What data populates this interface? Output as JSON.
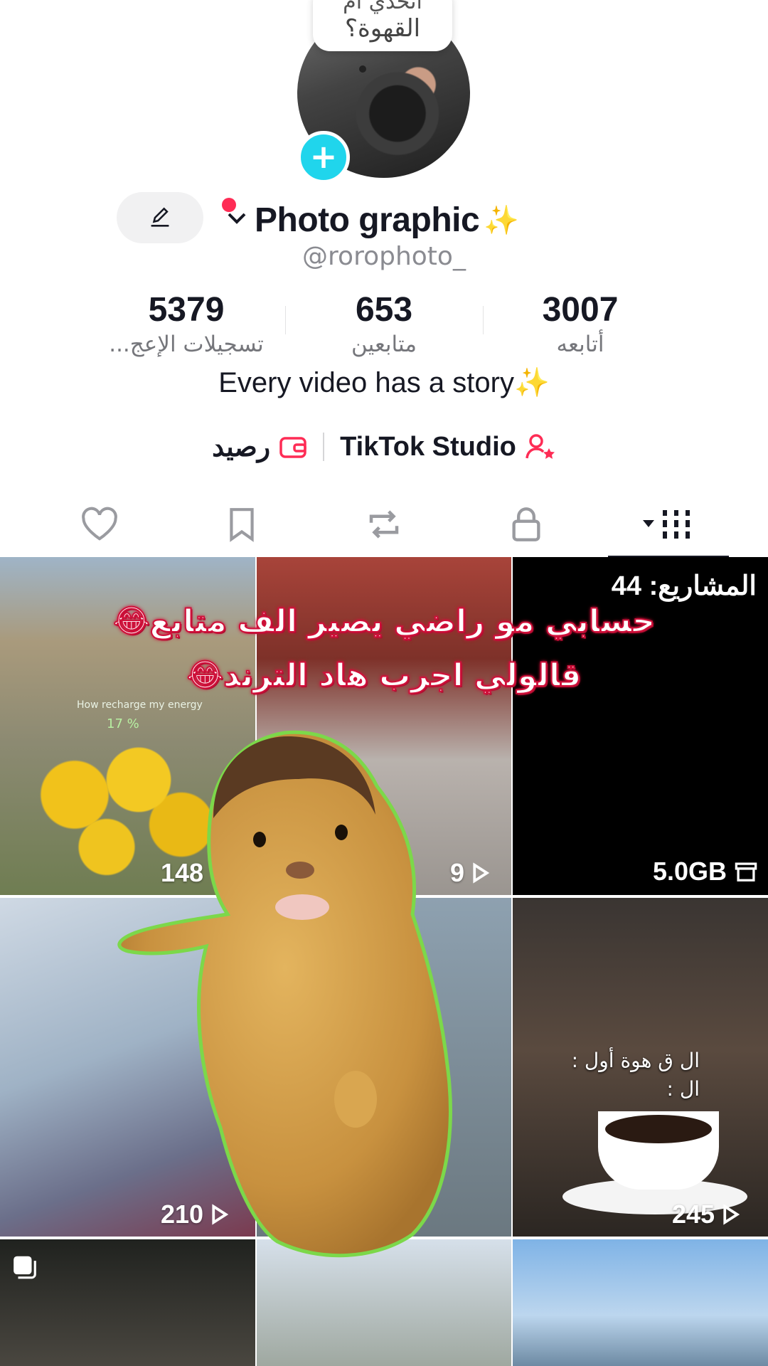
{
  "header": {
    "avatar_bubble_line1": "اتحدي أم",
    "avatar_bubble_line2": "القهوة؟",
    "display_name": "Photo graphic",
    "name_emoji": "✨",
    "username": "@rorophoto_"
  },
  "stats": [
    {
      "value": "3007",
      "label": "أتابعه"
    },
    {
      "value": "653",
      "label": "متابعين"
    },
    {
      "value": "5379",
      "label": "تسجيلات الإعج..."
    }
  ],
  "bio": "Every video has a story",
  "bio_emoji": "✨",
  "links": {
    "studio": "TikTok Studio",
    "balance": "رصيد"
  },
  "tabs": [
    {
      "icon": "grid-icon",
      "active": true
    },
    {
      "icon": "lock-icon"
    },
    {
      "icon": "repost-icon"
    },
    {
      "icon": "bookmark-icon"
    },
    {
      "icon": "heart-icon"
    }
  ],
  "grid": {
    "tile1_views": "148",
    "tile1_energy_text": "How recharge my energy",
    "tile1_battery": "17 %",
    "tile2_views": "9",
    "tile3_projects": "المشاريع: 44",
    "tile3_storage": "5.0GB",
    "tile4_views": "210",
    "tile6_text_line1": "ال ق هوة أول :",
    "tile6_text_line2": "ال :",
    "tile6_views": "245"
  },
  "overlay": {
    "caption_line1": "حسابي مو راضي يصير الف متابع😂",
    "caption_line2": "قالولي اجرب هاد الترند😂"
  },
  "colors": {
    "accent_pink": "#fe2c55",
    "badge_cyan": "#20d5ec",
    "caption_stroke": "#d0103a"
  }
}
